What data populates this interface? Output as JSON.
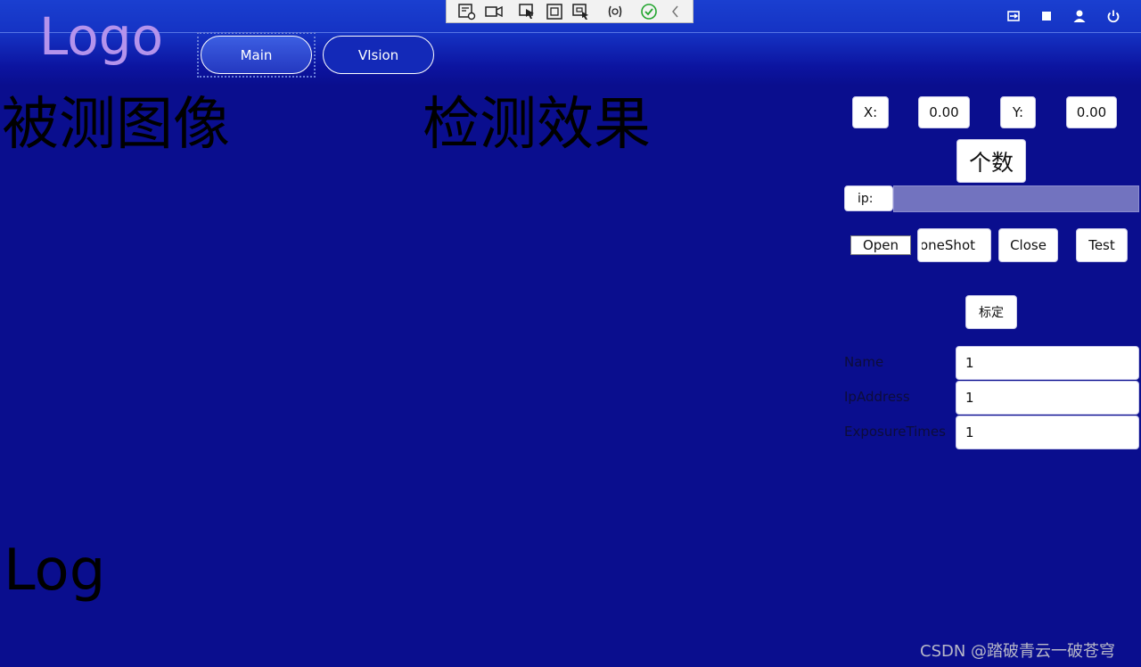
{
  "header": {
    "logo": "Logo",
    "nav": {
      "main_label": "Main",
      "vision_label": "VIsion"
    }
  },
  "debug_toolbar": {
    "icons": [
      "live-visual-tree-icon",
      "record-icon",
      "select-element-icon",
      "display-layout-icon",
      "track-focus-icon",
      "hot-reload-icon",
      "check-icon",
      "collapse-chevron-icon"
    ]
  },
  "window_controls": [
    "swap-icon",
    "stop-icon",
    "user-icon",
    "power-icon"
  ],
  "main": {
    "image_label": "被测图像",
    "result_label": "检测效果",
    "log_label": "Log"
  },
  "panel": {
    "x_label": "X:",
    "x_value": "0.00",
    "y_label": "Y:",
    "y_value": "0.00",
    "count_label": "个数",
    "ip_label": "ip:",
    "buttons": {
      "open": "Open",
      "oneshot": "oneShot",
      "close": "Close",
      "test": "Test",
      "calibrate": "标定"
    },
    "form": [
      {
        "label": "Name",
        "value": "1"
      },
      {
        "label": "IpAddress",
        "value": "1"
      },
      {
        "label": "ExposureTimes",
        "value": "1"
      }
    ]
  },
  "watermark": "CSDN @踏破青云一破苍穹",
  "colors": {
    "background": "#0a0e8e",
    "header_top": "#1a3fd0",
    "logo": "#b493ec",
    "ip_bar": "#7273bf"
  }
}
